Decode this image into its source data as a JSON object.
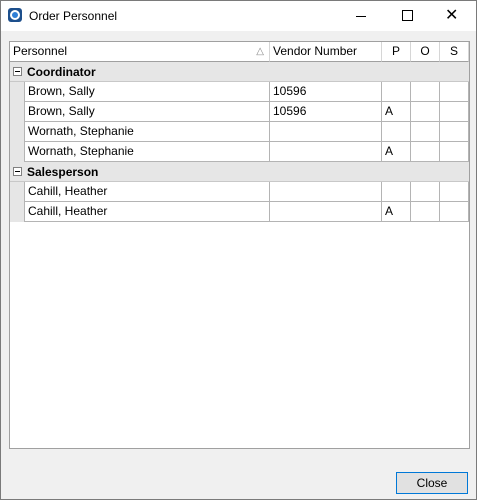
{
  "window": {
    "title": "Order Personnel",
    "close_glyph": "✕"
  },
  "columns": {
    "personnel": "Personnel",
    "vendor_number": "Vendor Number",
    "p": "P",
    "o": "O",
    "s": "S",
    "sort_glyph": "△"
  },
  "groups": [
    {
      "label": "Coordinator",
      "rows": [
        {
          "name": "Brown, Sally",
          "vendor": "10596",
          "p": "",
          "o": "",
          "s": ""
        },
        {
          "name": "Brown, Sally",
          "vendor": "10596",
          "p": "A",
          "o": "",
          "s": ""
        },
        {
          "name": "Wornath, Stephanie",
          "vendor": "",
          "p": "",
          "o": "",
          "s": ""
        },
        {
          "name": "Wornath, Stephanie",
          "vendor": "",
          "p": "A",
          "o": "",
          "s": ""
        }
      ]
    },
    {
      "label": "Salesperson",
      "rows": [
        {
          "name": "Cahill, Heather",
          "vendor": "",
          "p": "",
          "o": "",
          "s": ""
        },
        {
          "name": "Cahill, Heather",
          "vendor": "",
          "p": "A",
          "o": "",
          "s": ""
        }
      ]
    }
  ],
  "footer": {
    "close_label": "Close"
  }
}
